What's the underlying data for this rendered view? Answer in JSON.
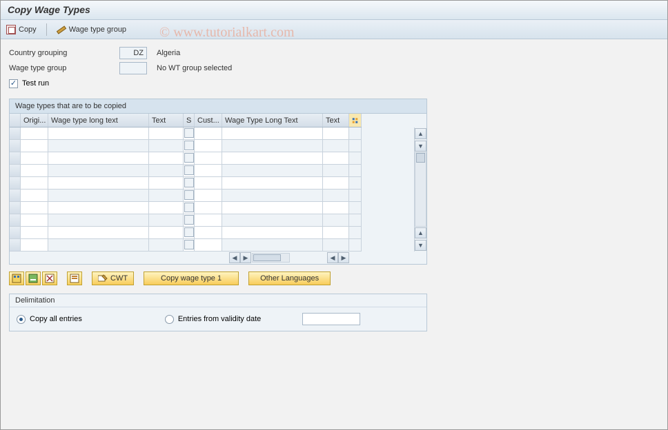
{
  "title": "Copy Wage Types",
  "watermark": "© www.tutorialkart.com",
  "toolbar": {
    "copy": "Copy",
    "wage_type_group": "Wage type group"
  },
  "form": {
    "country_grouping_label": "Country grouping",
    "country_grouping_value": "DZ",
    "country_grouping_text": "Algeria",
    "wage_type_group_label": "Wage type group",
    "wage_type_group_value": "",
    "wage_type_group_text": "No WT group selected",
    "test_run_label": "Test run",
    "test_run_checked": true
  },
  "grid": {
    "title": "Wage types that are to be copied",
    "columns": {
      "origi": "Origi...",
      "wtlt": "Wage type long text",
      "text": "Text",
      "s": "S",
      "cust": "Cust...",
      "wtlt2": "Wage Type Long Text",
      "text2": "Text"
    },
    "row_count": 10
  },
  "buttons": {
    "cwt": "CWT",
    "copy_wt1": "Copy wage type 1",
    "other_lang": "Other Languages"
  },
  "delimitation": {
    "header": "Delimitation",
    "copy_all": "Copy all entries",
    "entries_from": "Entries from validity date",
    "selected": "copy_all",
    "date_value": ""
  }
}
